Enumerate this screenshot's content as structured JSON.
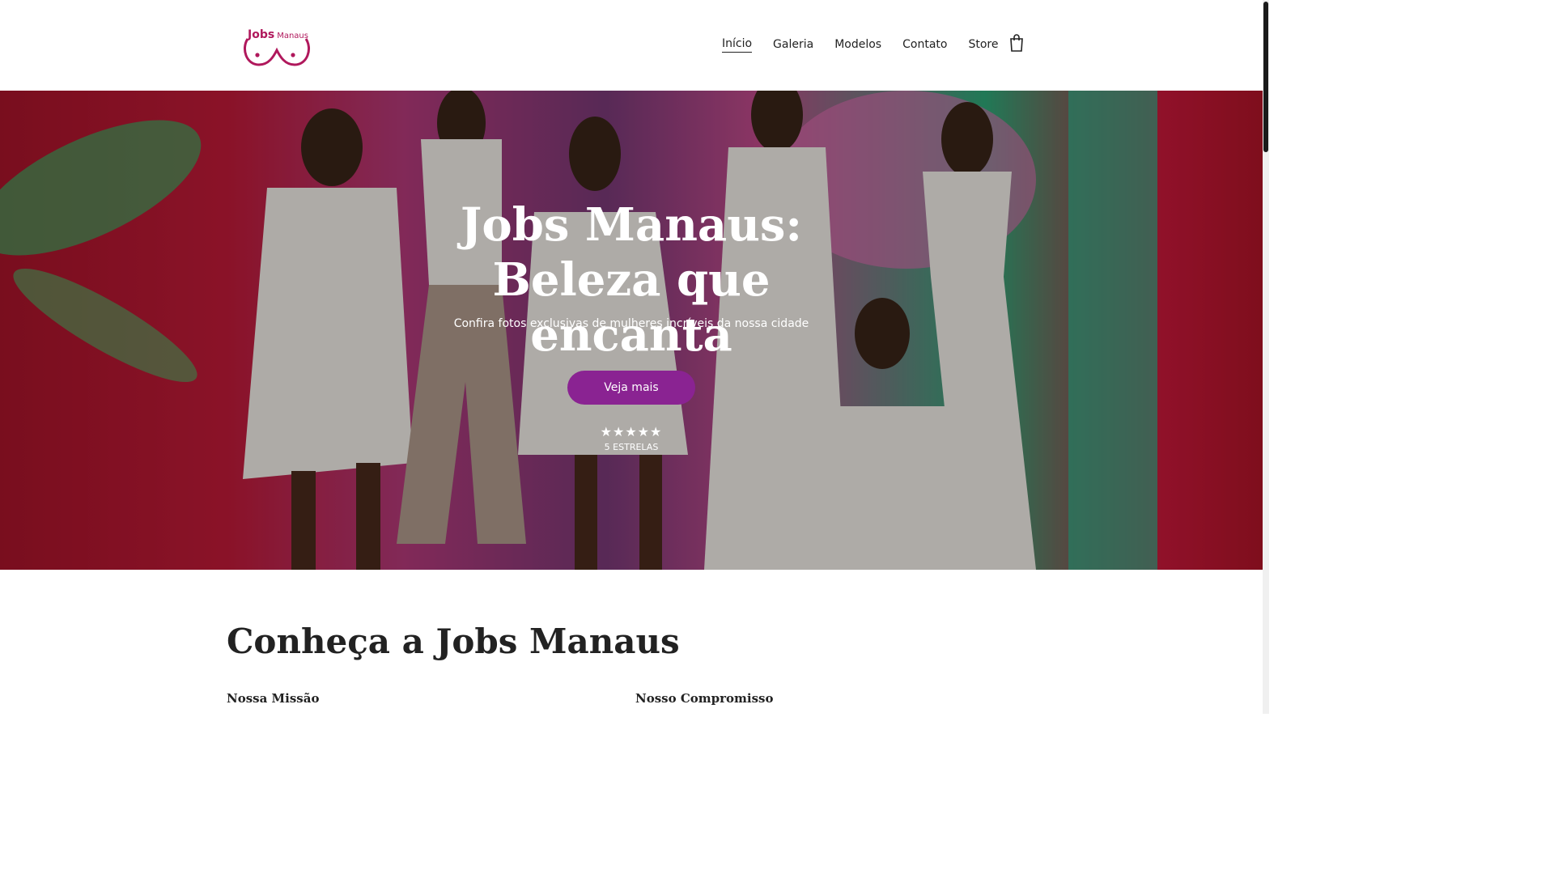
{
  "header": {
    "logo": {
      "bold": "Jobs",
      "small": "Manaus"
    },
    "nav": [
      {
        "label": "Início",
        "active": true
      },
      {
        "label": "Galeria"
      },
      {
        "label": "Modelos"
      },
      {
        "label": "Contato"
      },
      {
        "label": "Store"
      }
    ],
    "cart_icon": "shopping-bag-icon"
  },
  "hero": {
    "title": "Jobs Manaus: Beleza que encanta",
    "subtitle": "Confira fotos exclusivas de mulheres incríveis da nossa cidade",
    "cta": "Veja mais",
    "rating": {
      "stars": "★★★★★",
      "value": 5,
      "max": 5,
      "label": "5 ESTRELAS"
    }
  },
  "about": {
    "title": "Conheça a Jobs Manaus",
    "columns": [
      {
        "title": "Nossa Missão"
      },
      {
        "title": "Nosso Compromisso"
      }
    ]
  },
  "colors": {
    "accent": "#8a2392",
    "logo": "#b0185c"
  }
}
